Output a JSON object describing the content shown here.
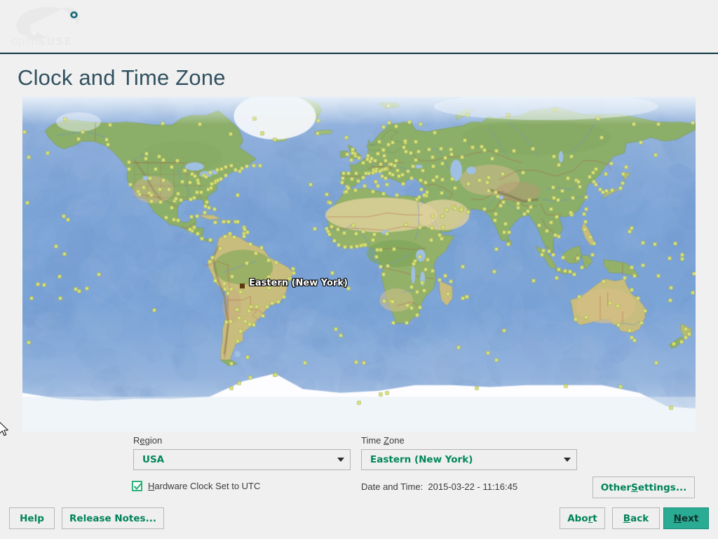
{
  "header": {
    "logo_pre": "open",
    "logo_strong": "SUSE",
    "logo_name": "opensuse-chameleon-logo"
  },
  "page": {
    "title": "Clock and Time Zone"
  },
  "map": {
    "selected_label": "Eastern (New York)",
    "ocean_color": "#7ea6d6",
    "land_color": "#9cb36a",
    "marker_color": "#dde87a",
    "selected_marker_color": "#5c3a10"
  },
  "form": {
    "region_label_pre": "R",
    "region_label_acc": "e",
    "region_label_post": "gion",
    "region_value": "USA",
    "timezone_label_pre": "Time ",
    "timezone_label_acc": "Z",
    "timezone_label_post": "one",
    "timezone_value": "Eastern (New York)",
    "hwclock_label_pre": "",
    "hwclock_label_acc": "H",
    "hwclock_label_post": "ardware Clock Set to UTC",
    "hwclock_checked": true,
    "datetime_label": "Date and Time:",
    "datetime_value": "2015-03-22 - 11:16:45"
  },
  "buttons": {
    "other_settings_pre": "Other ",
    "other_settings_acc": "S",
    "other_settings_post": "ettings...",
    "help": "Help",
    "release_notes": "Release Notes...",
    "abort_pre": "Abo",
    "abort_acc": "r",
    "abort_post": "t",
    "back_pre": "",
    "back_acc": "B",
    "back_post": "ack",
    "next_pre": "",
    "next_acc": "N",
    "next_post": "ext"
  },
  "colors": {
    "banner_left": "#0f4351",
    "banner_right": "#73ba44",
    "accent_green": "#00875a",
    "primary_button": "#2aab93",
    "title": "#31515f",
    "page_bg": "#f0f0f0"
  }
}
